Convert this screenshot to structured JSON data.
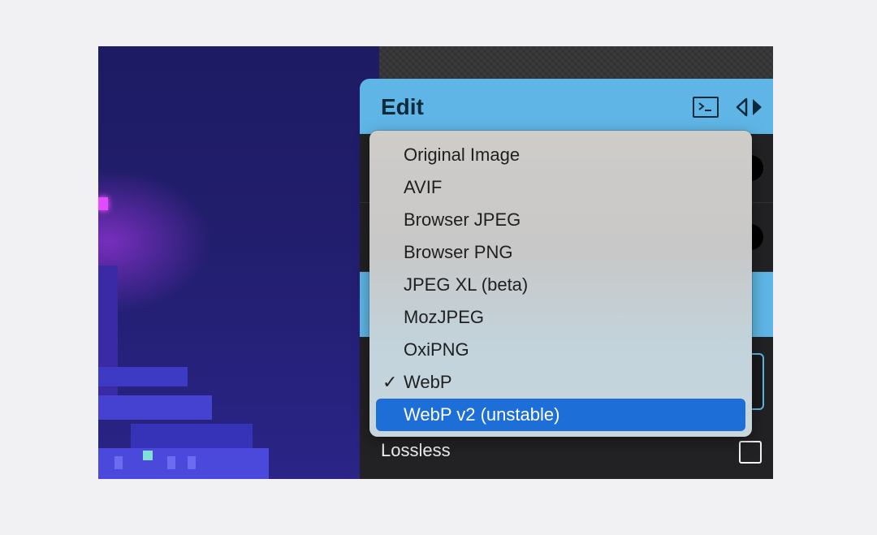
{
  "panel": {
    "title": "Edit"
  },
  "format_menu": {
    "items": [
      {
        "label": "Original Image",
        "checked": false,
        "highlighted": false
      },
      {
        "label": "AVIF",
        "checked": false,
        "highlighted": false
      },
      {
        "label": "Browser JPEG",
        "checked": false,
        "highlighted": false
      },
      {
        "label": "Browser PNG",
        "checked": false,
        "highlighted": false
      },
      {
        "label": "JPEG XL (beta)",
        "checked": false,
        "highlighted": false
      },
      {
        "label": "MozJPEG",
        "checked": false,
        "highlighted": false
      },
      {
        "label": "OxiPNG",
        "checked": false,
        "highlighted": false
      },
      {
        "label": "WebP",
        "checked": true,
        "highlighted": false
      },
      {
        "label": "WebP v2 (unstable)",
        "checked": false,
        "highlighted": true
      }
    ],
    "check_glyph": "✓",
    "highlight_color": "#1d6fd7"
  },
  "options": {
    "lossless_label": "Lossless",
    "lossless_checked": false
  },
  "icons": {
    "terminal": "terminal-icon",
    "compare": "compare-arrows-icon",
    "checkmark": "checkmark-icon"
  },
  "colors": {
    "accent": "#5fb6e6",
    "panel_bg": "#222224",
    "page_bg": "#f1f1f3"
  }
}
